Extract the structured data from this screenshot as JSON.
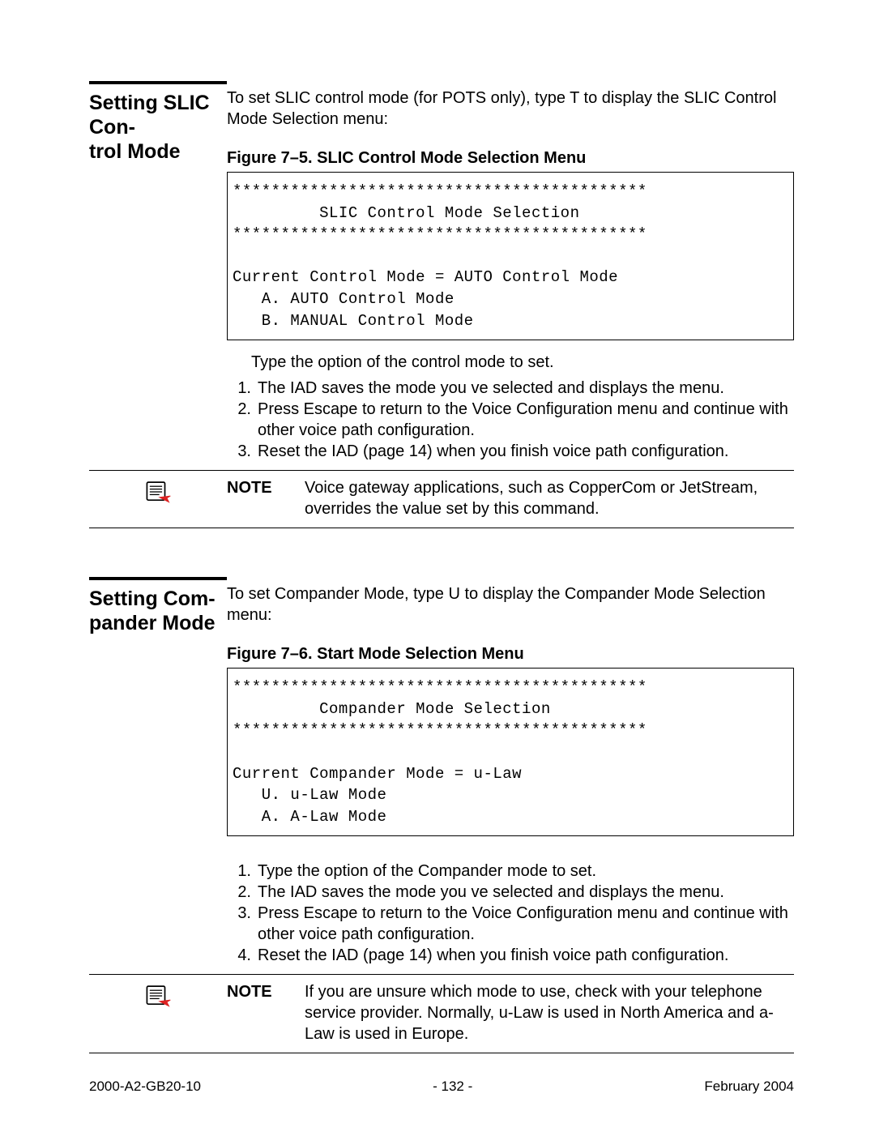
{
  "section1": {
    "title": "Setting SLIC Con-\ntrol Mode",
    "intro": "To set SLIC control mode (for POTS only), type T to display the SLIC Control Mode Selection menu:",
    "figure_caption": "Figure 7–5.  SLIC Control Mode Selection Menu",
    "terminal": "*******************************************\n         SLIC Control Mode Selection\n*******************************************\n\nCurrent Control Mode = AUTO Control Mode\n   A. AUTO Control Mode\n   B. MANUAL Control Mode",
    "steps_intro": "Type the option of the control mode to set.",
    "steps": [
      "The IAD saves the mode you ve selected and displays the menu.",
      "Press Escape to return to the Voice Configuration menu and continue with other voice path configuration.",
      "Reset the IAD (page 14) when you finish voice path configuration."
    ],
    "note_label": "NOTE",
    "note_text": "Voice gateway applications, such as CopperCom or JetStream, overrides the value set by this command."
  },
  "section2": {
    "title": "Setting Com-\npander Mode",
    "intro": "To set Compander Mode, type U to display the Compander Mode Selection menu:",
    "figure_caption": "Figure 7–6.  Start Mode Selection Menu",
    "terminal": "*******************************************\n         Compander Mode Selection\n*******************************************\n\nCurrent Compander Mode = u-Law\n   U. u-Law Mode\n   A. A-Law Mode",
    "steps": [
      "Type the option of the Compander mode to set.",
      "The IAD saves the mode you ve selected and displays the menu.",
      "Press Escape to return to the Voice Configuration menu and continue with other voice path configuration.",
      "Reset the IAD (page 14) when you finish voice path configuration."
    ],
    "note_label": "NOTE",
    "note_text": "If you are unsure which mode to use, check with your telephone service provider. Normally, u-Law is used in North America and a-Law is used in Europe."
  },
  "footer": {
    "left": "2000-A2-GB20-10",
    "center": "- 132 -",
    "right": "February 2004"
  }
}
